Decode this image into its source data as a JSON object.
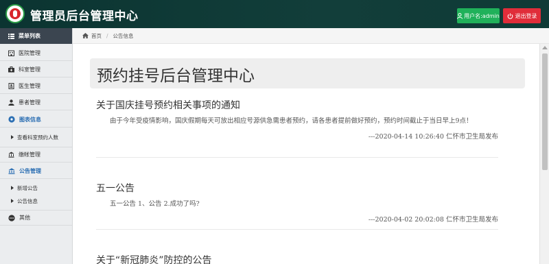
{
  "header": {
    "title": "管理员后台管理中心",
    "user_button": "用户名:admin",
    "logout_button": "退出登录"
  },
  "sidebar": {
    "heading": "菜单列表",
    "items": [
      {
        "label": "医院管理",
        "icon": "hospital-icon"
      },
      {
        "label": "科室管理",
        "icon": "medkit-icon"
      },
      {
        "label": "医生管理",
        "icon": "doctor-icon"
      },
      {
        "label": "患者管理",
        "icon": "patient-icon"
      },
      {
        "label": "图表信息",
        "icon": "chart-icon",
        "active": true
      },
      {
        "label": "缴帐管理",
        "icon": "payment-icon"
      },
      {
        "label": "公告管理",
        "icon": "bank-icon",
        "active": true
      },
      {
        "label": "其他",
        "icon": "more-icon"
      }
    ],
    "sub_items": {
      "chart": [
        "查看科室预约人数"
      ],
      "notice": [
        "新增公告",
        "公告信息"
      ]
    }
  },
  "breadcrumb": {
    "home": "首页",
    "current": "公告信息"
  },
  "page": {
    "jumbo_title": "预约挂号后台管理中心"
  },
  "notices": [
    {
      "title": "关于国庆挂号预约相关事项的通知",
      "body": "由于今年受疫情影响，国庆假期每天可放出相应号源供急需患者预约，请各患者提前做好预约，预约时间截止于当日早上9点！",
      "footer": "---2020-04-14 10:26:40 仁怀市卫生局发布"
    },
    {
      "title": "五一公告",
      "body": "五一公告 1、公告 2.成功了吗?",
      "footer": "---2020-04-02 20:02:08 仁怀市卫生局发布"
    },
    {
      "title": "关于“新冠肺炎”防控的公告",
      "body": "",
      "footer": ""
    }
  ],
  "colors": {
    "topbar": "#0b3431",
    "user_button": "#20b15a",
    "logout_button": "#e02d3a",
    "sidebar_header": "#3b4550",
    "active_link": "#2c6fb3"
  }
}
